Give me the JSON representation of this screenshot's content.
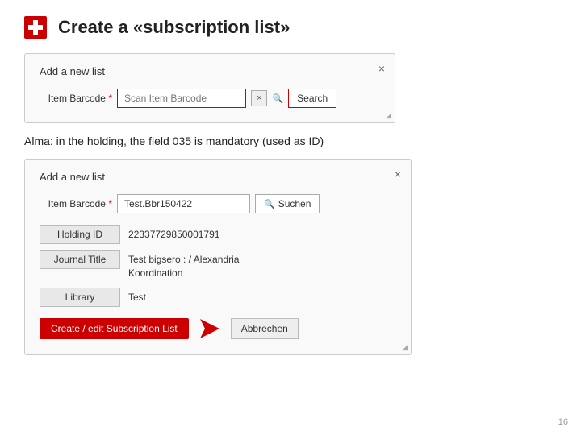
{
  "header": {
    "title": "Create a «subscription list»"
  },
  "dialog1": {
    "title": "Add a new list",
    "close_symbol": "×",
    "form": {
      "label": "Item Barcode",
      "required": "*",
      "placeholder": "Scan Item Barcode",
      "clear_symbol": "×",
      "search_label": "Search"
    },
    "resize_symbol": "◢"
  },
  "subtitle": "Alma: in the holding, the field 035 is mandatory (used as ID)",
  "dialog2": {
    "title": "Add a new list",
    "close_symbol": "×",
    "form": {
      "label": "Item Barcode",
      "required": "*",
      "barcode_value": "Test.Bbr150422",
      "search_icon": "🔍",
      "suchen_label": "Suchen"
    },
    "fields": [
      {
        "label": "Holding ID",
        "value": "22337729850001791"
      },
      {
        "label": "Journal Title",
        "value": "Test bigsero : / Alexandria\nKoordination"
      },
      {
        "label": "Library",
        "value": "Test"
      }
    ],
    "create_btn_label": "Create / edit Subscription List",
    "abbrechen_label": "Abbrechen",
    "resize_symbol": "◢"
  },
  "page_number": "16"
}
